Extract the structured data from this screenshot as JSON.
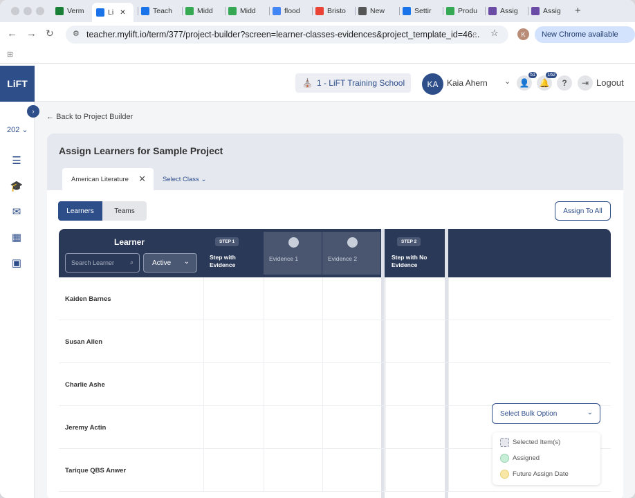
{
  "browser": {
    "tabs": [
      {
        "label": "Verm",
        "color": "#1a7f37"
      },
      {
        "label": "Li",
        "color": "#1a73e8"
      },
      {
        "label": "Teach",
        "color": "#1a73e8"
      },
      {
        "label": "Midd",
        "color": "#34a853"
      },
      {
        "label": "Midd",
        "color": "#34a853"
      },
      {
        "label": "flood",
        "color": "#4285f4"
      },
      {
        "label": "Bristo",
        "color": "#ea4335"
      },
      {
        "label": "New",
        "color": "#555555"
      },
      {
        "label": "Settir",
        "color": "#1a73e8"
      },
      {
        "label": "Produ",
        "color": "#34a853"
      },
      {
        "label": "Assig",
        "color": "#6a4ba5"
      },
      {
        "label": "Assig",
        "color": "#6a4ba5"
      }
    ],
    "url": "teacher.mylift.io/term/377/project-builder?screen=learner-classes-evidences&project_template_id=46...",
    "new_chrome": "New Chrome available",
    "profile_initial": "K"
  },
  "header": {
    "logo": "LiFT",
    "school": "1 - LiFT Training School",
    "user_initials": "KA",
    "user_name": "Kaia Ahern",
    "badge_learners": "51",
    "badge_notifications": "162",
    "logout": "Logout"
  },
  "sidebar": {
    "year": "202"
  },
  "page": {
    "back": "Back to Project Builder",
    "title": "Assign Learners for Sample Project",
    "class_tab": "American Literature",
    "select_class": "Select Class",
    "toggle_learners": "Learners",
    "toggle_teams": "Teams",
    "assign_all": "Assign To All"
  },
  "grid": {
    "learner_header": "Learner",
    "search_placeholder": "Search Learner",
    "status_filter": "Active",
    "step1_badge": "STEP 1",
    "step1_title": "Step with Evidence",
    "evidence1": "Evidence 1",
    "evidence2": "Evidence 2",
    "step2_badge": "STEP 2",
    "step2_title": "Step with No Evidence",
    "learners": [
      "Kaiden Barnes",
      "Susan Allen",
      "Charlie Ashe",
      "Jeremy Actin",
      "Tarique QBS Anwer"
    ]
  },
  "bulk": {
    "placeholder": "Select Bulk Option",
    "legend": [
      {
        "label": "Selected Item(s)",
        "color": "#e6e8ee"
      },
      {
        "label": "Assigned",
        "color": "#c7efd8"
      },
      {
        "label": "Future Assign Date",
        "color": "#f8e7a6"
      }
    ]
  }
}
